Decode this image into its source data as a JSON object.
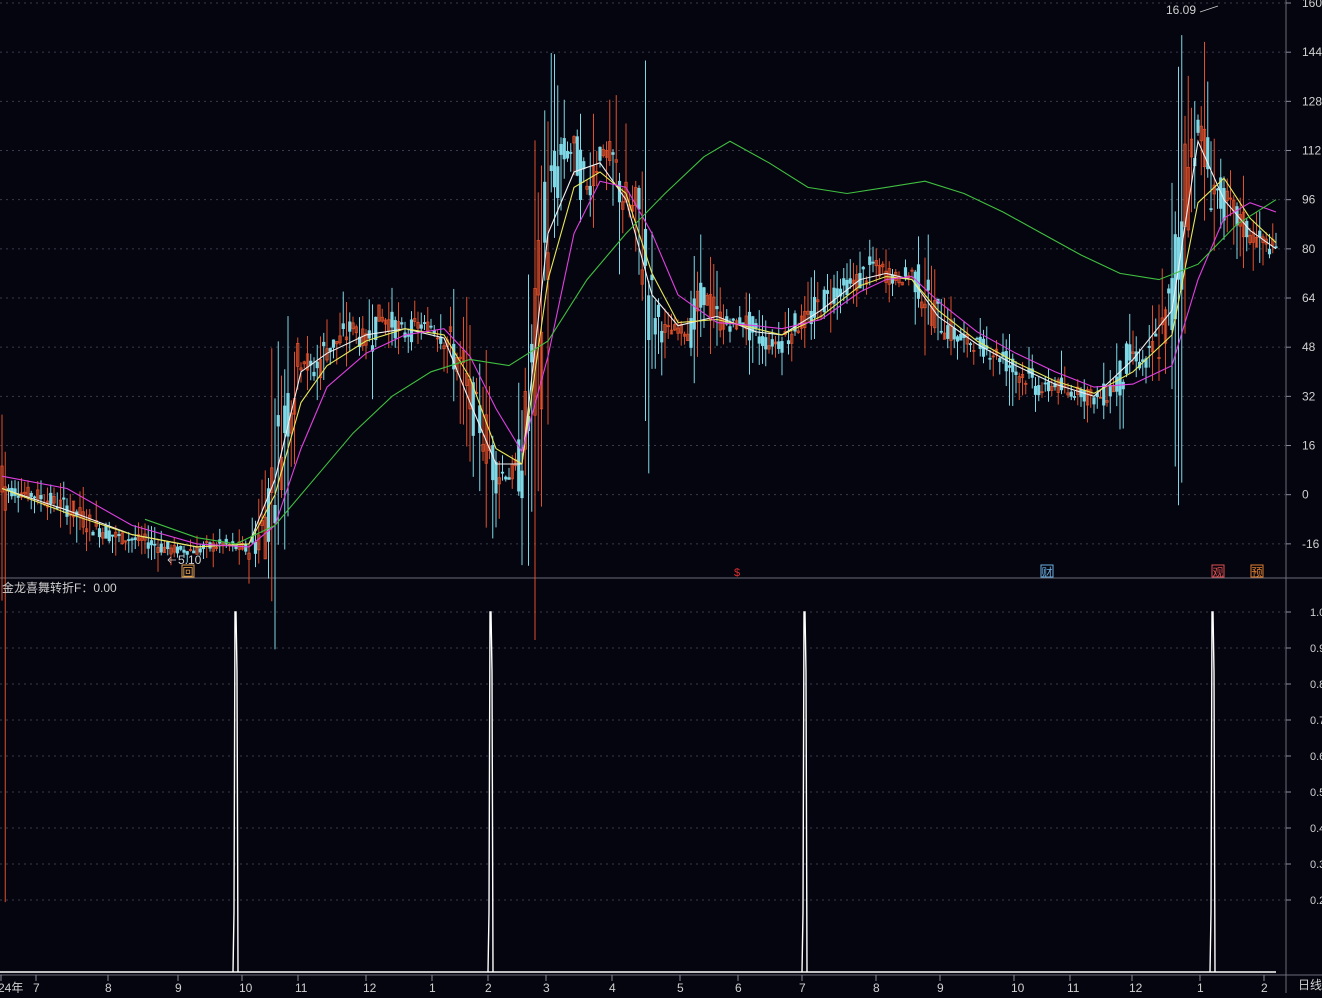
{
  "indicator": {
    "name": "金龙喜舞转折F",
    "separator": "：",
    "value": "0.00"
  },
  "period_label": "日线",
  "colors": {
    "background": "#05050f",
    "up_candle": "#e0502a",
    "down_candle": "#7fd8e6",
    "ma_white": "#f0f0f0",
    "ma_yellow": "#e8e85a",
    "ma_magenta": "#e040e0",
    "ma_green": "#40c040",
    "grid": "#3a3a4a",
    "axis_text": "#d0d0d0",
    "signal_line": "#ffffff"
  },
  "chart_data": [
    {
      "type": "candlestick",
      "title": "",
      "xlabel": "",
      "ylabel": "",
      "ylim": [
        -18,
        160
      ],
      "y_ticks": [
        "160",
        "144",
        "128",
        "112",
        "96",
        "80",
        "64",
        "48",
        "32",
        "16",
        "0",
        "-16"
      ],
      "y_tick_values": [
        160,
        144,
        128,
        112,
        96,
        80,
        64,
        48,
        32,
        16,
        0,
        -16
      ],
      "x_ticks": [
        "24年",
        "7",
        "8",
        "9",
        "10",
        "11",
        "12",
        "1",
        "2",
        "3",
        "4",
        "5",
        "6",
        "7",
        "8",
        "9",
        "10",
        "11",
        "12",
        "1",
        "2"
      ],
      "annotations": {
        "high_label": "16.09",
        "low_label": "5.10"
      },
      "event_markers": [
        "回",
        "$",
        "财",
        "观",
        "预"
      ],
      "close_path": [
        [
          0,
          2
        ],
        [
          5,
          0
        ],
        [
          10,
          -4
        ],
        [
          14,
          -10
        ],
        [
          18,
          -14
        ],
        [
          22,
          -15
        ],
        [
          26,
          -18
        ],
        [
          30,
          -18
        ],
        [
          34,
          -16
        ],
        [
          38,
          -18
        ],
        [
          40,
          -12
        ],
        [
          42,
          8
        ],
        [
          44,
          30
        ],
        [
          46,
          45
        ],
        [
          48,
          40
        ],
        [
          50,
          48
        ],
        [
          52,
          50
        ],
        [
          54,
          55
        ],
        [
          56,
          50
        ],
        [
          58,
          58
        ],
        [
          60,
          56
        ],
        [
          62,
          52
        ],
        [
          64,
          55
        ],
        [
          66,
          55
        ],
        [
          68,
          52
        ],
        [
          70,
          45
        ],
        [
          72,
          30
        ],
        [
          74,
          22
        ],
        [
          76,
          8
        ],
        [
          78,
          6
        ],
        [
          80,
          10
        ],
        [
          82,
          40
        ],
        [
          84,
          90
        ],
        [
          86,
          110
        ],
        [
          88,
          112
        ],
        [
          90,
          100
        ],
        [
          92,
          112
        ],
        [
          94,
          108
        ],
        [
          96,
          95
        ],
        [
          98,
          90
        ],
        [
          100,
          60
        ],
        [
          102,
          53
        ],
        [
          104,
          54
        ],
        [
          106,
          53
        ],
        [
          108,
          65
        ],
        [
          110,
          58
        ],
        [
          112,
          55
        ],
        [
          114,
          57
        ],
        [
          116,
          52
        ],
        [
          118,
          49
        ],
        [
          120,
          50
        ],
        [
          122,
          55
        ],
        [
          124,
          57
        ],
        [
          126,
          62
        ],
        [
          128,
          66
        ],
        [
          130,
          68
        ],
        [
          132,
          70
        ],
        [
          134,
          75
        ],
        [
          136,
          72
        ],
        [
          138,
          70
        ],
        [
          140,
          72
        ],
        [
          142,
          65
        ],
        [
          144,
          58
        ],
        [
          146,
          53
        ],
        [
          148,
          50
        ],
        [
          150,
          49
        ],
        [
          152,
          47
        ],
        [
          154,
          45
        ],
        [
          156,
          40
        ],
        [
          158,
          38
        ],
        [
          160,
          34
        ],
        [
          162,
          36
        ],
        [
          164,
          33
        ],
        [
          166,
          34
        ],
        [
          168,
          31
        ],
        [
          170,
          33
        ],
        [
          172,
          38
        ],
        [
          174,
          46
        ],
        [
          176,
          42
        ],
        [
          178,
          50
        ],
        [
          180,
          60
        ],
        [
          182,
          100
        ],
        [
          184,
          120
        ],
        [
          186,
          102
        ],
        [
          188,
          95
        ],
        [
          190,
          90
        ],
        [
          192,
          85
        ],
        [
          194,
          82
        ],
        [
          196,
          80
        ]
      ],
      "series": [
        {
          "name": "MA white",
          "values": [
            [
              0,
              2
            ],
            [
              10,
              -5
            ],
            [
              20,
              -13
            ],
            [
              30,
              -17
            ],
            [
              38,
              -16
            ],
            [
              42,
              5
            ],
            [
              46,
              40
            ],
            [
              50,
              46
            ],
            [
              56,
              52
            ],
            [
              62,
              54
            ],
            [
              68,
              51
            ],
            [
              72,
              30
            ],
            [
              76,
              10
            ],
            [
              80,
              10
            ],
            [
              84,
              85
            ],
            [
              88,
              105
            ],
            [
              92,
              108
            ],
            [
              96,
              96
            ],
            [
              100,
              65
            ],
            [
              104,
              55
            ],
            [
              110,
              58
            ],
            [
              116,
              53
            ],
            [
              120,
              52
            ],
            [
              126,
              60
            ],
            [
              132,
              70
            ],
            [
              136,
              72
            ],
            [
              140,
              70
            ],
            [
              144,
              58
            ],
            [
              150,
              49
            ],
            [
              156,
              42
            ],
            [
              162,
              36
            ],
            [
              168,
              32
            ],
            [
              174,
              44
            ],
            [
              180,
              60
            ],
            [
              184,
              115
            ],
            [
              188,
              96
            ],
            [
              192,
              86
            ],
            [
              196,
              80
            ]
          ]
        },
        {
          "name": "MA yellow",
          "values": [
            [
              0,
              2
            ],
            [
              10,
              -6
            ],
            [
              20,
              -13
            ],
            [
              30,
              -17
            ],
            [
              38,
              -16
            ],
            [
              42,
              0
            ],
            [
              46,
              30
            ],
            [
              50,
              42
            ],
            [
              56,
              50
            ],
            [
              62,
              54
            ],
            [
              68,
              52
            ],
            [
              72,
              38
            ],
            [
              76,
              15
            ],
            [
              80,
              10
            ],
            [
              84,
              70
            ],
            [
              88,
              100
            ],
            [
              92,
              105
            ],
            [
              96,
              98
            ],
            [
              100,
              72
            ],
            [
              104,
              56
            ],
            [
              110,
              57
            ],
            [
              116,
              54
            ],
            [
              120,
              52
            ],
            [
              126,
              58
            ],
            [
              132,
              68
            ],
            [
              136,
              71
            ],
            [
              140,
              70
            ],
            [
              144,
              60
            ],
            [
              150,
              50
            ],
            [
              156,
              43
            ],
            [
              162,
              37
            ],
            [
              168,
              33
            ],
            [
              174,
              40
            ],
            [
              180,
              52
            ],
            [
              184,
              95
            ],
            [
              188,
              103
            ],
            [
              192,
              90
            ],
            [
              196,
              82
            ]
          ]
        },
        {
          "name": "MA magenta",
          "values": [
            [
              0,
              6
            ],
            [
              10,
              2
            ],
            [
              20,
              -10
            ],
            [
              30,
              -16
            ],
            [
              38,
              -17
            ],
            [
              42,
              -10
            ],
            [
              46,
              15
            ],
            [
              50,
              35
            ],
            [
              56,
              46
            ],
            [
              62,
              52
            ],
            [
              68,
              54
            ],
            [
              72,
              45
            ],
            [
              76,
              28
            ],
            [
              80,
              14
            ],
            [
              84,
              45
            ],
            [
              88,
              85
            ],
            [
              92,
              102
            ],
            [
              96,
              100
            ],
            [
              100,
              85
            ],
            [
              104,
              65
            ],
            [
              110,
              56
            ],
            [
              116,
              55
            ],
            [
              120,
              54
            ],
            [
              126,
              57
            ],
            [
              132,
              66
            ],
            [
              136,
              70
            ],
            [
              140,
              71
            ],
            [
              144,
              63
            ],
            [
              150,
              53
            ],
            [
              156,
              46
            ],
            [
              162,
              40
            ],
            [
              168,
              35
            ],
            [
              174,
              36
            ],
            [
              180,
              42
            ],
            [
              184,
              70
            ],
            [
              188,
              90
            ],
            [
              192,
              95
            ],
            [
              196,
              92
            ]
          ]
        },
        {
          "name": "MA green",
          "values": [
            [
              22,
              -8
            ],
            [
              30,
              -14
            ],
            [
              36,
              -16
            ],
            [
              42,
              -10
            ],
            [
              48,
              5
            ],
            [
              54,
              20
            ],
            [
              60,
              32
            ],
            [
              66,
              40
            ],
            [
              72,
              44
            ],
            [
              78,
              42
            ],
            [
              84,
              50
            ],
            [
              90,
              70
            ],
            [
              96,
              85
            ],
            [
              102,
              98
            ],
            [
              108,
              110
            ],
            [
              112,
              115
            ],
            [
              118,
              108
            ],
            [
              124,
              100
            ],
            [
              130,
              98
            ],
            [
              136,
              100
            ],
            [
              142,
              102
            ],
            [
              148,
              98
            ],
            [
              154,
              92
            ],
            [
              160,
              85
            ],
            [
              166,
              78
            ],
            [
              172,
              72
            ],
            [
              178,
              70
            ],
            [
              184,
              75
            ],
            [
              190,
              88
            ],
            [
              196,
              96
            ]
          ]
        }
      ]
    },
    {
      "type": "line",
      "title": "",
      "xlabel": "",
      "ylabel": "",
      "ylim": [
        0,
        1.05
      ],
      "y_ticks": [
        "1.0",
        "0.9",
        "0.8",
        "0.7",
        "0.6",
        "0.5",
        "0.4",
        "0.3",
        "0.2"
      ],
      "y_tick_values": [
        1.0,
        0.9,
        0.8,
        0.7,
        0.6,
        0.5,
        0.4,
        0.3,
        0.2
      ],
      "series": [
        {
          "name": "",
          "signals": [
            {
              "month_position": "10",
              "value": 1.0
            },
            {
              "month_position": "2",
              "value": 1.0
            },
            {
              "month_position": "7",
              "value": 1.0
            },
            {
              "month_position": "1",
              "value": 1.0
            }
          ]
        }
      ]
    }
  ]
}
